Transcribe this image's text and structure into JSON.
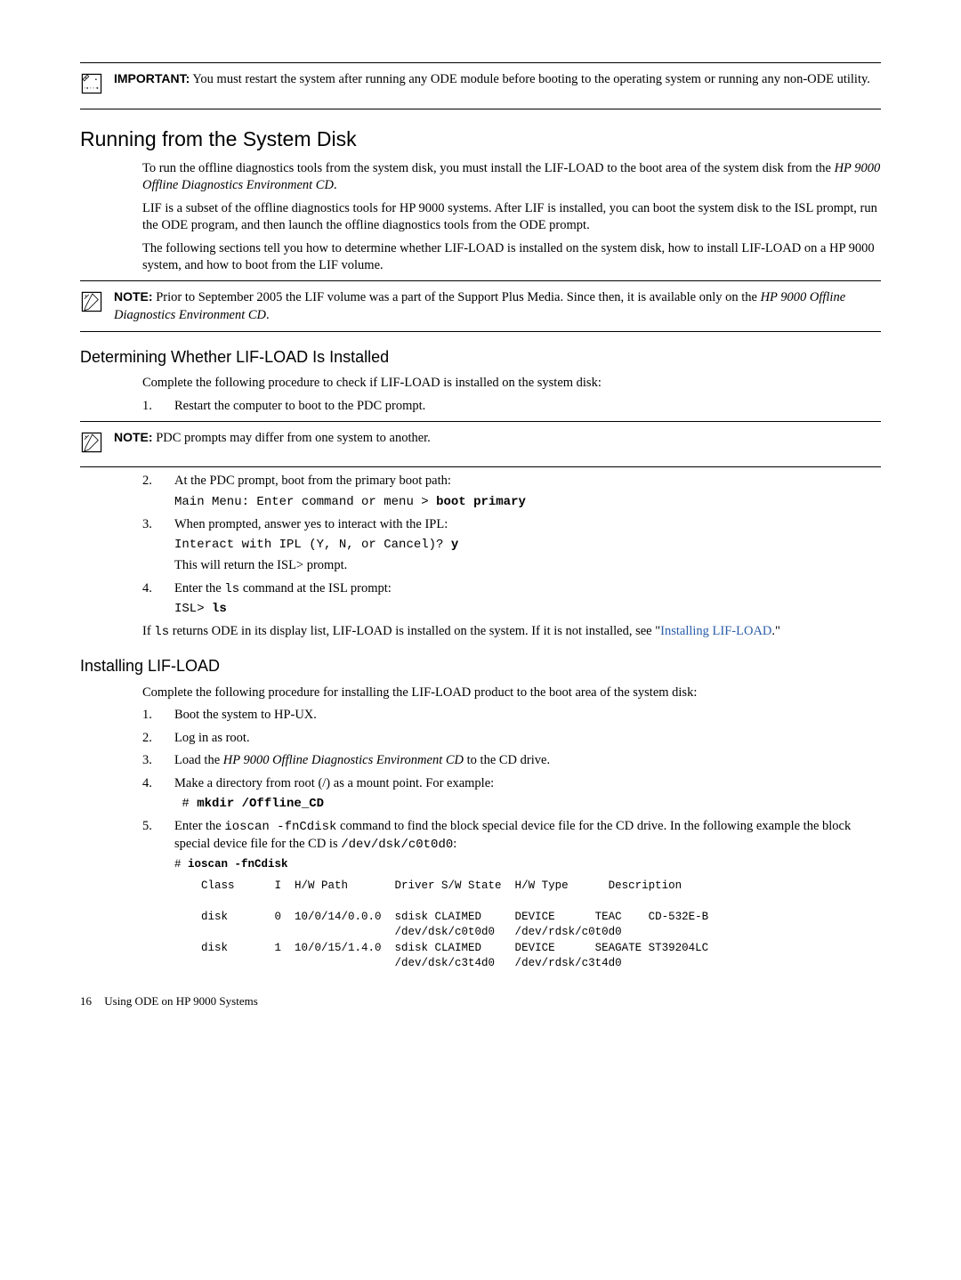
{
  "important": {
    "label": "IMPORTANT:",
    "text_before": "You must restart the system after running any ODE module before booting to the operating system or running any non-ODE utility."
  },
  "section_run_disk": {
    "title": "Running from the System Disk",
    "p1a": "To run the offline diagnostics tools from the system disk, you must install the LIF-LOAD to the boot area of the system disk from the ",
    "p1i": "HP 9000 Offline Diagnostics Environment CD",
    "p1b": ".",
    "p2": "LIF is a subset of the offline diagnostics tools for HP 9000 systems. After LIF is installed, you can boot the system disk to the ISL prompt, run the ODE program, and then launch the offline diagnostics tools from the ODE prompt.",
    "p3": "The following sections tell you how to determine whether LIF-LOAD is installed on the system disk, how to install LIF-LOAD on a HP 9000 system, and how to boot from the LIF volume."
  },
  "note1": {
    "label": "NOTE:",
    "t1": "Prior to September 2005 the LIF volume was a part of the Support Plus Media. Since then, it is available only on the ",
    "t1i": "HP 9000 Offline Diagnostics Environment CD",
    "t1b": "."
  },
  "sub_det": {
    "title": "Determining Whether LIF-LOAD Is Installed",
    "p1": "Complete the following procedure to check if LIF-LOAD is installed on the system disk:",
    "step1": "Restart the computer to boot to the PDC prompt."
  },
  "note2": {
    "label": "NOTE:",
    "text": "PDC prompts may differ from one system to another."
  },
  "det_cont": {
    "step2": "At the PDC prompt, boot from the primary boot path:",
    "step2_code_pre": "Main Menu: Enter command or menu > ",
    "step2_code_bold": "boot primary",
    "step3": "When prompted, answer yes to interact with the IPL:",
    "step3_code_pre": "Interact with IPL (Y, N, or Cancel)? ",
    "step3_code_bold": "y",
    "step3_after": "This will return the ISL> prompt.",
    "step4a": "Enter the ",
    "step4_code": "ls",
    "step4b": " command at the ISL prompt:",
    "step4_block_pre": "ISL> ",
    "step4_block_bold": "ls",
    "p_after_a": "If ",
    "p_after_code": "ls",
    "p_after_b": " returns ODE in its display list, LIF-LOAD is installed on the system. If it is not installed, see \"",
    "p_after_link": "Installing LIF-LOAD",
    "p_after_c": ".\""
  },
  "sub_install": {
    "title": "Installing LIF-LOAD",
    "p1": "Complete the following procedure for installing the LIF-LOAD product to the boot area of the system disk:",
    "step1": "Boot the system to HP-UX.",
    "step2": "Log in as root.",
    "step3a": "Load the ",
    "step3i": "HP 9000 Offline Diagnostics Environment CD",
    "step3b": " to the CD drive.",
    "step4": "Make a directory from root (/) as a mount point. For example:",
    "step4_code_pre": " # ",
    "step4_code_bold": "mkdir /Offline_CD",
    "step5a": "Enter the ",
    "step5_code": "ioscan -fnCdisk",
    "step5b": " command to find the block special device file for the CD drive. In the following example the block special device file for the CD is ",
    "step5_code2": "/dev/dsk/c0t0d0",
    "step5c": ":",
    "step5_block_pre": "# ",
    "step5_block_bold": "ioscan -fnCdisk"
  },
  "ioscan_output": "    Class      I  H/W Path       Driver S/W State  H/W Type      Description\n\n    disk       0  10/0/14/0.0.0  sdisk CLAIMED     DEVICE      TEAC    CD-532E-B\n                                 /dev/dsk/c0t0d0   /dev/rdsk/c0t0d0\n    disk       1  10/0/15/1.4.0  sdisk CLAIMED     DEVICE      SEAGATE ST39204LC\n                                 /dev/dsk/c3t4d0   /dev/rdsk/c3t4d0",
  "footer": {
    "page": "16",
    "title": "Using ODE on HP 9000 Systems"
  }
}
